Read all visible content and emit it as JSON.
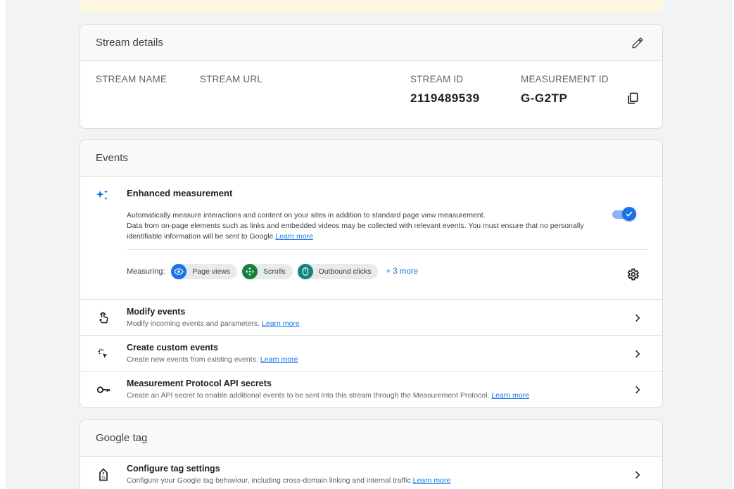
{
  "stream_details": {
    "title": "Stream details",
    "columns": {
      "stream_name_label": "STREAM NAME",
      "stream_url_label": "STREAM URL",
      "stream_id_label": "STREAM ID",
      "stream_id_value": "2119489539",
      "measurement_id_label": "MEASUREMENT ID",
      "measurement_id_value": "G-G2TP"
    },
    "icons": {
      "edit": "pencil-icon",
      "copy": "copy-icon"
    }
  },
  "events": {
    "title": "Events",
    "enhanced": {
      "title": "Enhanced measurement",
      "desc_1": "Automatically measure interactions and content on your sites in addition to standard page view measurement.",
      "desc_2": "Data from on-page elements such as links and embedded videos may be collected with relevant events. You must ensure that no personally identifiable information will be sent to Google.",
      "learn_more": "Learn more",
      "toggle_on": true,
      "measuring_label": "Measuring:",
      "chips": [
        {
          "label": "Page views",
          "icon": "eye-icon",
          "color": "#1a73e8"
        },
        {
          "label": "Scrolls",
          "icon": "scroll-icon",
          "color": "#188038"
        },
        {
          "label": "Outbound clicks",
          "icon": "mouse-icon",
          "color": "#12857f"
        }
      ],
      "more": "+ 3 more"
    },
    "rows": [
      {
        "title": "Modify events",
        "sub": "Modify incoming events and parameters.",
        "link": "Learn more",
        "icon": "touch-hand-icon"
      },
      {
        "title": "Create custom events",
        "sub": "Create new events from existing events.",
        "link": "Learn more",
        "icon": "sparkle-click-icon"
      },
      {
        "title": "Measurement Protocol API secrets",
        "sub": "Create an API secret to enable additional events to be sent into this stream through the Measurement Protocol.",
        "link": "Learn more",
        "icon": "key-icon"
      }
    ]
  },
  "google_tag": {
    "title": "Google tag",
    "rows": [
      {
        "title": "Configure tag settings",
        "sub": "Configure your Google tag behaviour, including cross-domain linking and internal traffic.",
        "link": "Learn more",
        "icon": "tag-icon"
      }
    ]
  },
  "colors": {
    "accent": "#1a73e8",
    "card_header_bg": "#f8f9fa",
    "page_bg": "#f1f3f4",
    "banner": "#fef7e0"
  }
}
